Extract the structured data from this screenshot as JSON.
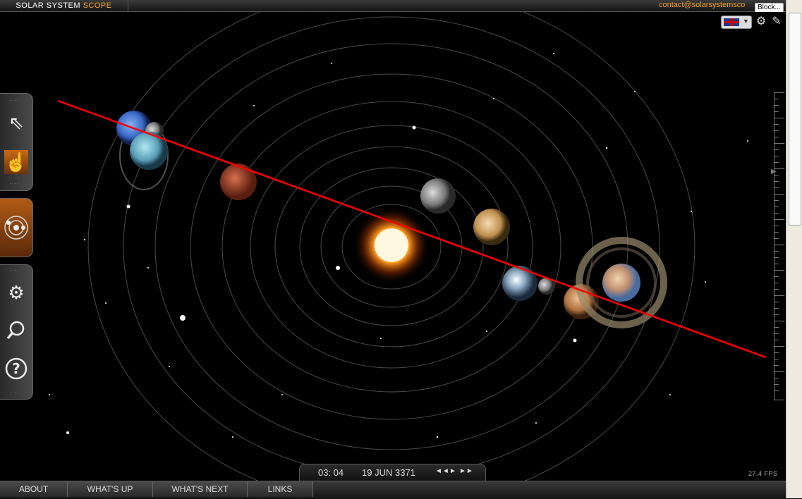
{
  "header": {
    "brand_main": "SOLAR SYSTEM",
    "brand_accent": "SCOPE",
    "contact": "contact@solarsystemsco",
    "tooltip": "Block..."
  },
  "toolbar_icons": [
    "help-pointer-icon",
    "hand-icon",
    "orbits-icon",
    "settings-icon",
    "search-icon",
    "help-icon"
  ],
  "time_control": {
    "time": "03: 04",
    "date": "19 JUN 3371",
    "rewind": "◄◄",
    "play": "►",
    "forward": "►►"
  },
  "fps": "27.4 FPS",
  "bottom_nav": [
    "ABOUT",
    "WHAT'S UP",
    "WHAT'S NEXT",
    "LINKS"
  ],
  "colors": {
    "accent": "#f0a020",
    "alignment_line": "#ff0000",
    "orbit": "#555555"
  }
}
